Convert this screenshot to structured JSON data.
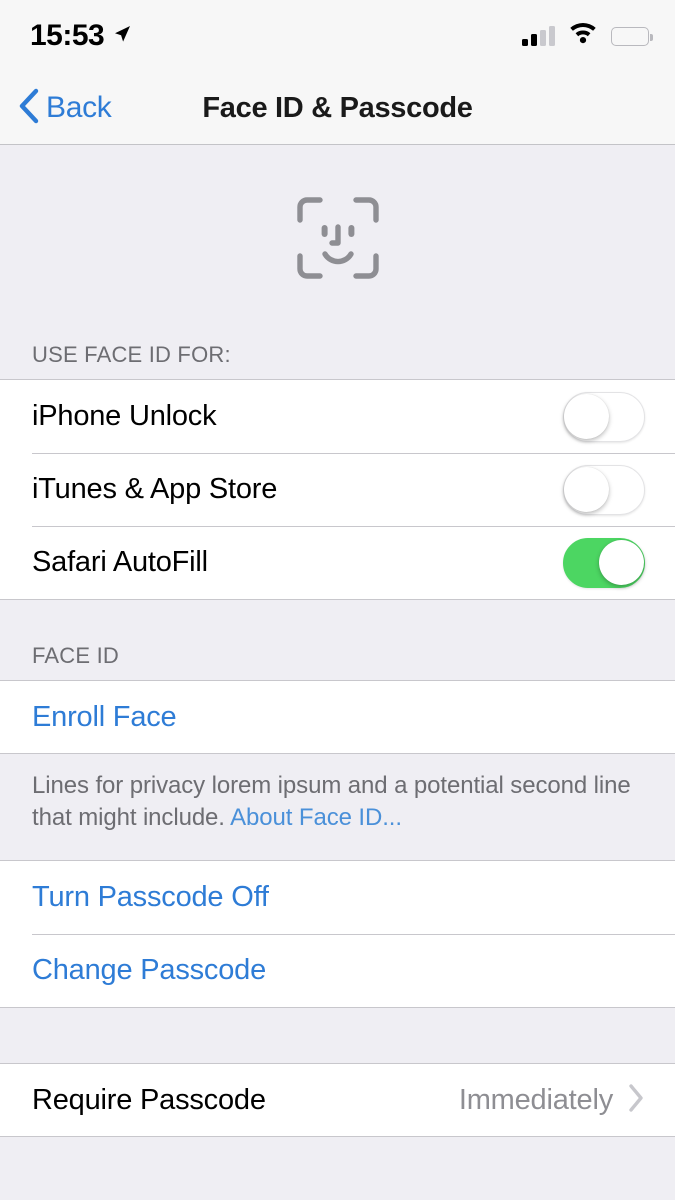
{
  "status_bar": {
    "time": "15:53",
    "location_icon": "location-arrow-icon",
    "signal_icon": "cellular-signal-icon",
    "signal_bars_filled": 2,
    "signal_bars_total": 4,
    "wifi_icon": "wifi-icon",
    "battery_icon": "battery-full-icon",
    "battery_level_pct": 100
  },
  "nav_bar": {
    "back_label": "Back",
    "back_icon": "chevron-left-icon",
    "title": "Face ID & Passcode"
  },
  "hero": {
    "icon": "face-id-icon"
  },
  "sections": [
    {
      "header": "USE FACE ID FOR:",
      "rows": [
        {
          "label": "iPhone Unlock",
          "type": "toggle",
          "on": false
        },
        {
          "label": "iTunes & App Store",
          "type": "toggle",
          "on": false
        },
        {
          "label": "Safari AutoFill",
          "type": "toggle",
          "on": true
        }
      ]
    },
    {
      "header": "FACE ID",
      "rows": [
        {
          "label": "Enroll Face",
          "type": "link"
        }
      ],
      "footer": {
        "text": "Lines for privacy lorem ipsum and a potential second line that might include. ",
        "link": "About Face ID..."
      }
    },
    {
      "header": "",
      "rows": [
        {
          "label": "Turn Passcode Off",
          "type": "link"
        },
        {
          "label": "Change Passcode",
          "type": "link"
        }
      ]
    },
    {
      "header": "",
      "rows": [
        {
          "label": "Require Passcode",
          "type": "value",
          "value": "Immediately",
          "disclosure": "chevron-right-icon"
        }
      ]
    }
  ],
  "colors": {
    "accent_blue": "#2E7CD6",
    "link_blue": "#4A90D9",
    "toggle_on_green": "#4CD662",
    "group_background": "#EFEEF3",
    "cell_background": "#FFFFFF",
    "separator": "#C8C7CC",
    "secondary_text": "#6D6D72",
    "value_text": "#8E8E93"
  }
}
